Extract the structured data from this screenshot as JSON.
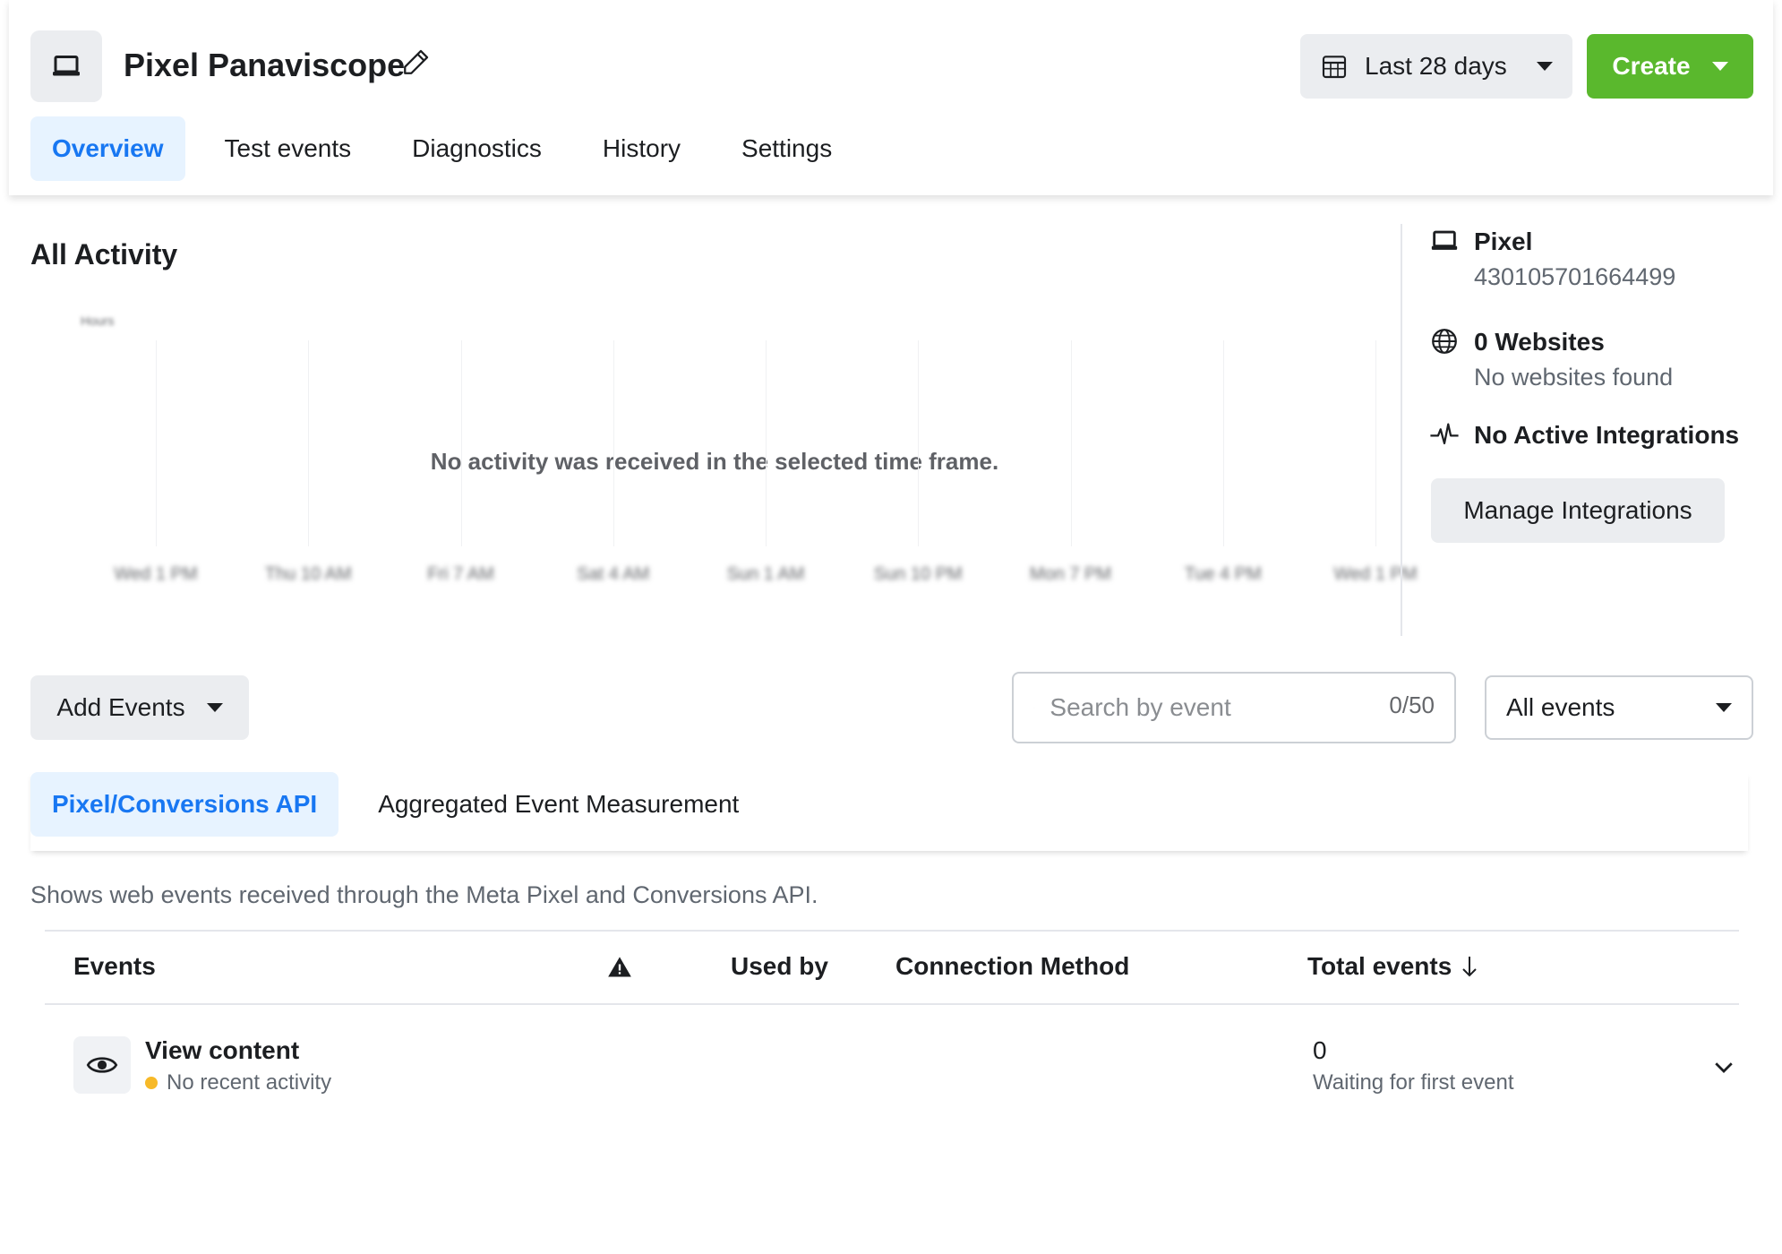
{
  "header": {
    "title": "Pixel Panaviscope",
    "date_range": "Last 28 days",
    "create_label": "Create",
    "tabs": [
      {
        "label": "Overview",
        "active": true
      },
      {
        "label": "Test events",
        "active": false
      },
      {
        "label": "Diagnostics",
        "active": false
      },
      {
        "label": "History",
        "active": false
      },
      {
        "label": "Settings",
        "active": false
      }
    ]
  },
  "activity": {
    "title": "All Activity",
    "empty_message": "No activity was received in the selected time frame.",
    "y_label": "Hours",
    "x_ticks": [
      "Wed 1 PM",
      "Thu 10 AM",
      "Fri 7 AM",
      "Sat 4 AM",
      "Sun 1 AM",
      "Sun 10 PM",
      "Mon 7 PM",
      "Tue 4 PM",
      "Wed 1 PM"
    ]
  },
  "side_panel": {
    "pixel_title": "Pixel",
    "pixel_id": "430105701664499",
    "websites_title": "0 Websites",
    "websites_sub": "No websites found",
    "integrations_title": "No Active Integrations",
    "manage_label": "Manage Integrations"
  },
  "toolbar": {
    "add_events_label": "Add Events",
    "search_placeholder": "Search by event",
    "search_counter": "0/50",
    "filter_value": "All events"
  },
  "subtabs": [
    {
      "label": "Pixel/Conversions API",
      "active": true
    },
    {
      "label": "Aggregated Event Measurement",
      "active": false
    }
  ],
  "description": "Shows web events received through the Meta Pixel and Conversions API.",
  "table": {
    "headers": {
      "events": "Events",
      "used_by": "Used by",
      "connection_method": "Connection Method",
      "total_events": "Total events"
    },
    "rows": [
      {
        "name": "View content",
        "status": "No recent activity",
        "total": "0",
        "total_sub": "Waiting for first event"
      }
    ]
  },
  "colors": {
    "accent": "#1877f2",
    "create_green": "#5ab82d",
    "status_dot": "#f7b928"
  }
}
